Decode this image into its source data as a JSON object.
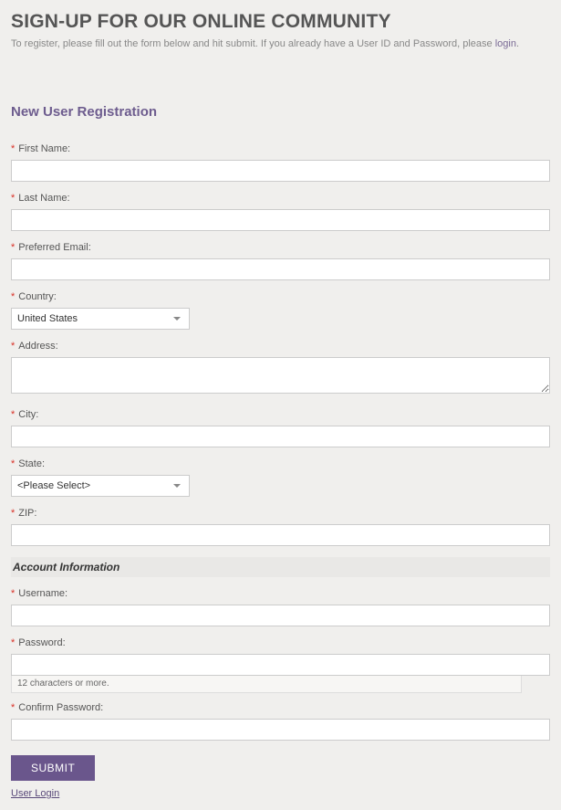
{
  "header": {
    "title": "SIGN-UP FOR OUR ONLINE COMMUNITY",
    "intro_prefix": "To register, please fill out the form below and hit submit.   If you already have a User ID and Password, please ",
    "login_link": "login",
    "intro_suffix": "."
  },
  "section_title": "New User Registration",
  "fields": {
    "first_name": {
      "label": "First Name:",
      "value": ""
    },
    "last_name": {
      "label": "Last Name:",
      "value": ""
    },
    "preferred_email": {
      "label": "Preferred Email:",
      "value": ""
    },
    "country": {
      "label": "Country:",
      "selected": "United States"
    },
    "address": {
      "label": "Address:",
      "value": ""
    },
    "city": {
      "label": "City:",
      "value": ""
    },
    "state": {
      "label": "State:",
      "selected": "<Please Select>"
    },
    "zip": {
      "label": "ZIP:",
      "value": ""
    },
    "username": {
      "label": "Username:",
      "value": ""
    },
    "password": {
      "label": "Password:",
      "value": "",
      "hint": "12 characters or more."
    },
    "confirm_password": {
      "label": "Confirm Password:",
      "value": ""
    }
  },
  "account_header": "Account Information",
  "submit_label": "SUBMIT",
  "user_login_link": "User Login",
  "required_marker": "*"
}
